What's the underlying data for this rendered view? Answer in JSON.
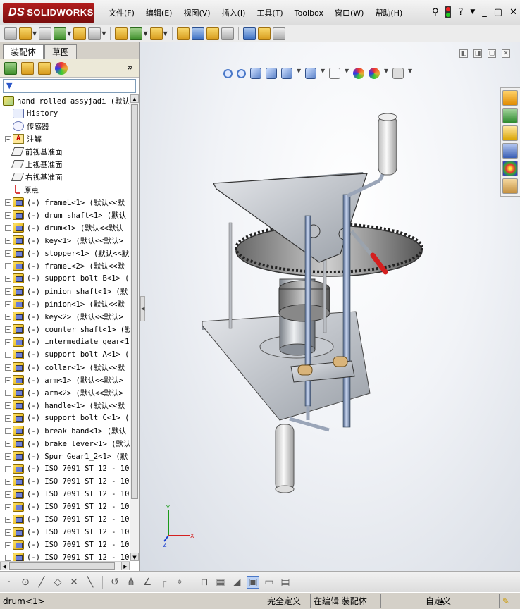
{
  "app": {
    "brand": "SOLIDWORKS",
    "brand_prefix": "DS"
  },
  "menu": [
    "文件(F)",
    "编辑(E)",
    "视图(V)",
    "插入(I)",
    "工具(T)",
    "Toolbox",
    "窗口(W)",
    "帮助(H)"
  ],
  "topright": {
    "help_icon": "?",
    "restore_icon": "▢"
  },
  "panel": {
    "tabs": [
      {
        "label": "装配体",
        "active": true
      },
      {
        "label": "草图",
        "active": false
      }
    ],
    "more_icon": "»",
    "filter_icon": "▼"
  },
  "tree": {
    "root": "hand rolled assyjadi  (默认",
    "items": [
      {
        "label": "History",
        "icon": "history-icon",
        "expand": false
      },
      {
        "label": "传感器",
        "icon": "sensor-icon",
        "expand": false
      },
      {
        "label": "注解",
        "icon": "annotation-icon",
        "expand": true
      },
      {
        "label": "前视基准面",
        "icon": "plane-icon",
        "expand": false
      },
      {
        "label": "上视基准面",
        "icon": "plane-icon",
        "expand": false
      },
      {
        "label": "右视基准面",
        "icon": "plane-icon",
        "expand": false
      },
      {
        "label": "原点",
        "icon": "origin-icon",
        "expand": false
      },
      {
        "label": "(-) frameL<1> (默认<<默",
        "icon": "part-icon",
        "expand": true
      },
      {
        "label": "(-) drum shaft<1> (默认",
        "icon": "part-icon",
        "expand": true
      },
      {
        "label": "(-) drum<1> (默认<<默认",
        "icon": "part-icon",
        "expand": true
      },
      {
        "label": "(-) key<1> (默认<<默认>",
        "icon": "part-icon",
        "expand": true
      },
      {
        "label": "(-) stopper<1> (默认<<默",
        "icon": "part-icon",
        "expand": true
      },
      {
        "label": "(-) frameL<2> (默认<<默",
        "icon": "part-icon",
        "expand": true
      },
      {
        "label": "(-) support bolt B<1> (",
        "icon": "part-icon",
        "expand": true
      },
      {
        "label": "(-) pinion shaft<1> (默",
        "icon": "part-icon",
        "expand": true
      },
      {
        "label": "(-) pinion<1> (默认<<默",
        "icon": "part-icon",
        "expand": true
      },
      {
        "label": "(-) key<2> (默认<<默认>",
        "icon": "part-icon",
        "expand": true
      },
      {
        "label": "(-) counter shaft<1> (默",
        "icon": "part-icon",
        "expand": true
      },
      {
        "label": "(-) intermediate gear<1",
        "icon": "part-icon",
        "expand": true
      },
      {
        "label": "(-) support bolt A<1> (",
        "icon": "part-icon",
        "expand": true
      },
      {
        "label": "(-) collar<1> (默认<<默",
        "icon": "part-icon",
        "expand": true
      },
      {
        "label": "(-) arm<1> (默认<<默认>",
        "icon": "part-icon",
        "expand": true
      },
      {
        "label": "(-) arm<2> (默认<<默认>",
        "icon": "part-icon",
        "expand": true
      },
      {
        "label": "(-) handle<1> (默认<<默",
        "icon": "part-icon",
        "expand": true
      },
      {
        "label": "(-) support bolt C<1> (",
        "icon": "part-icon",
        "expand": true
      },
      {
        "label": "(-) break band<1> (默认",
        "icon": "part-icon",
        "expand": true
      },
      {
        "label": "(-) brake lever<1> (默认",
        "icon": "part-icon",
        "expand": true
      },
      {
        "label": "(-) Spur Gear1_2<1> (默",
        "icon": "part-icon",
        "expand": true
      },
      {
        "label": "(-) ISO 7091 ST 12 - 10",
        "icon": "part-icon",
        "expand": true
      },
      {
        "label": "(-) ISO 7091 ST 12 - 10",
        "icon": "part-icon",
        "expand": true
      },
      {
        "label": "(-) ISO 7091 ST 12 - 10",
        "icon": "part-icon",
        "expand": true
      },
      {
        "label": "(-) ISO 7091 ST 12 - 10",
        "icon": "part-icon",
        "expand": true
      },
      {
        "label": "(-) ISO 7091 ST 12 - 10",
        "icon": "part-icon",
        "expand": true
      },
      {
        "label": "(-) ISO 7091 ST 12 - 10",
        "icon": "part-icon",
        "expand": true
      },
      {
        "label": "(-) ISO 7091 ST 12 - 10",
        "icon": "part-icon",
        "expand": true
      },
      {
        "label": "(-) ISO 7091 ST 12 - 10",
        "icon": "part-icon",
        "expand": true
      }
    ]
  },
  "triad": {
    "x": "X",
    "y": "Y",
    "z": "Z"
  },
  "status": {
    "selected": "drum<1>",
    "definition": "完全定义",
    "mode": "在编辑 装配体",
    "units": "自定义",
    "arrow": "▲"
  },
  "colors": {
    "accent": "#4a78c8",
    "brand": "#9a1414",
    "handle_red": "#d42020"
  }
}
